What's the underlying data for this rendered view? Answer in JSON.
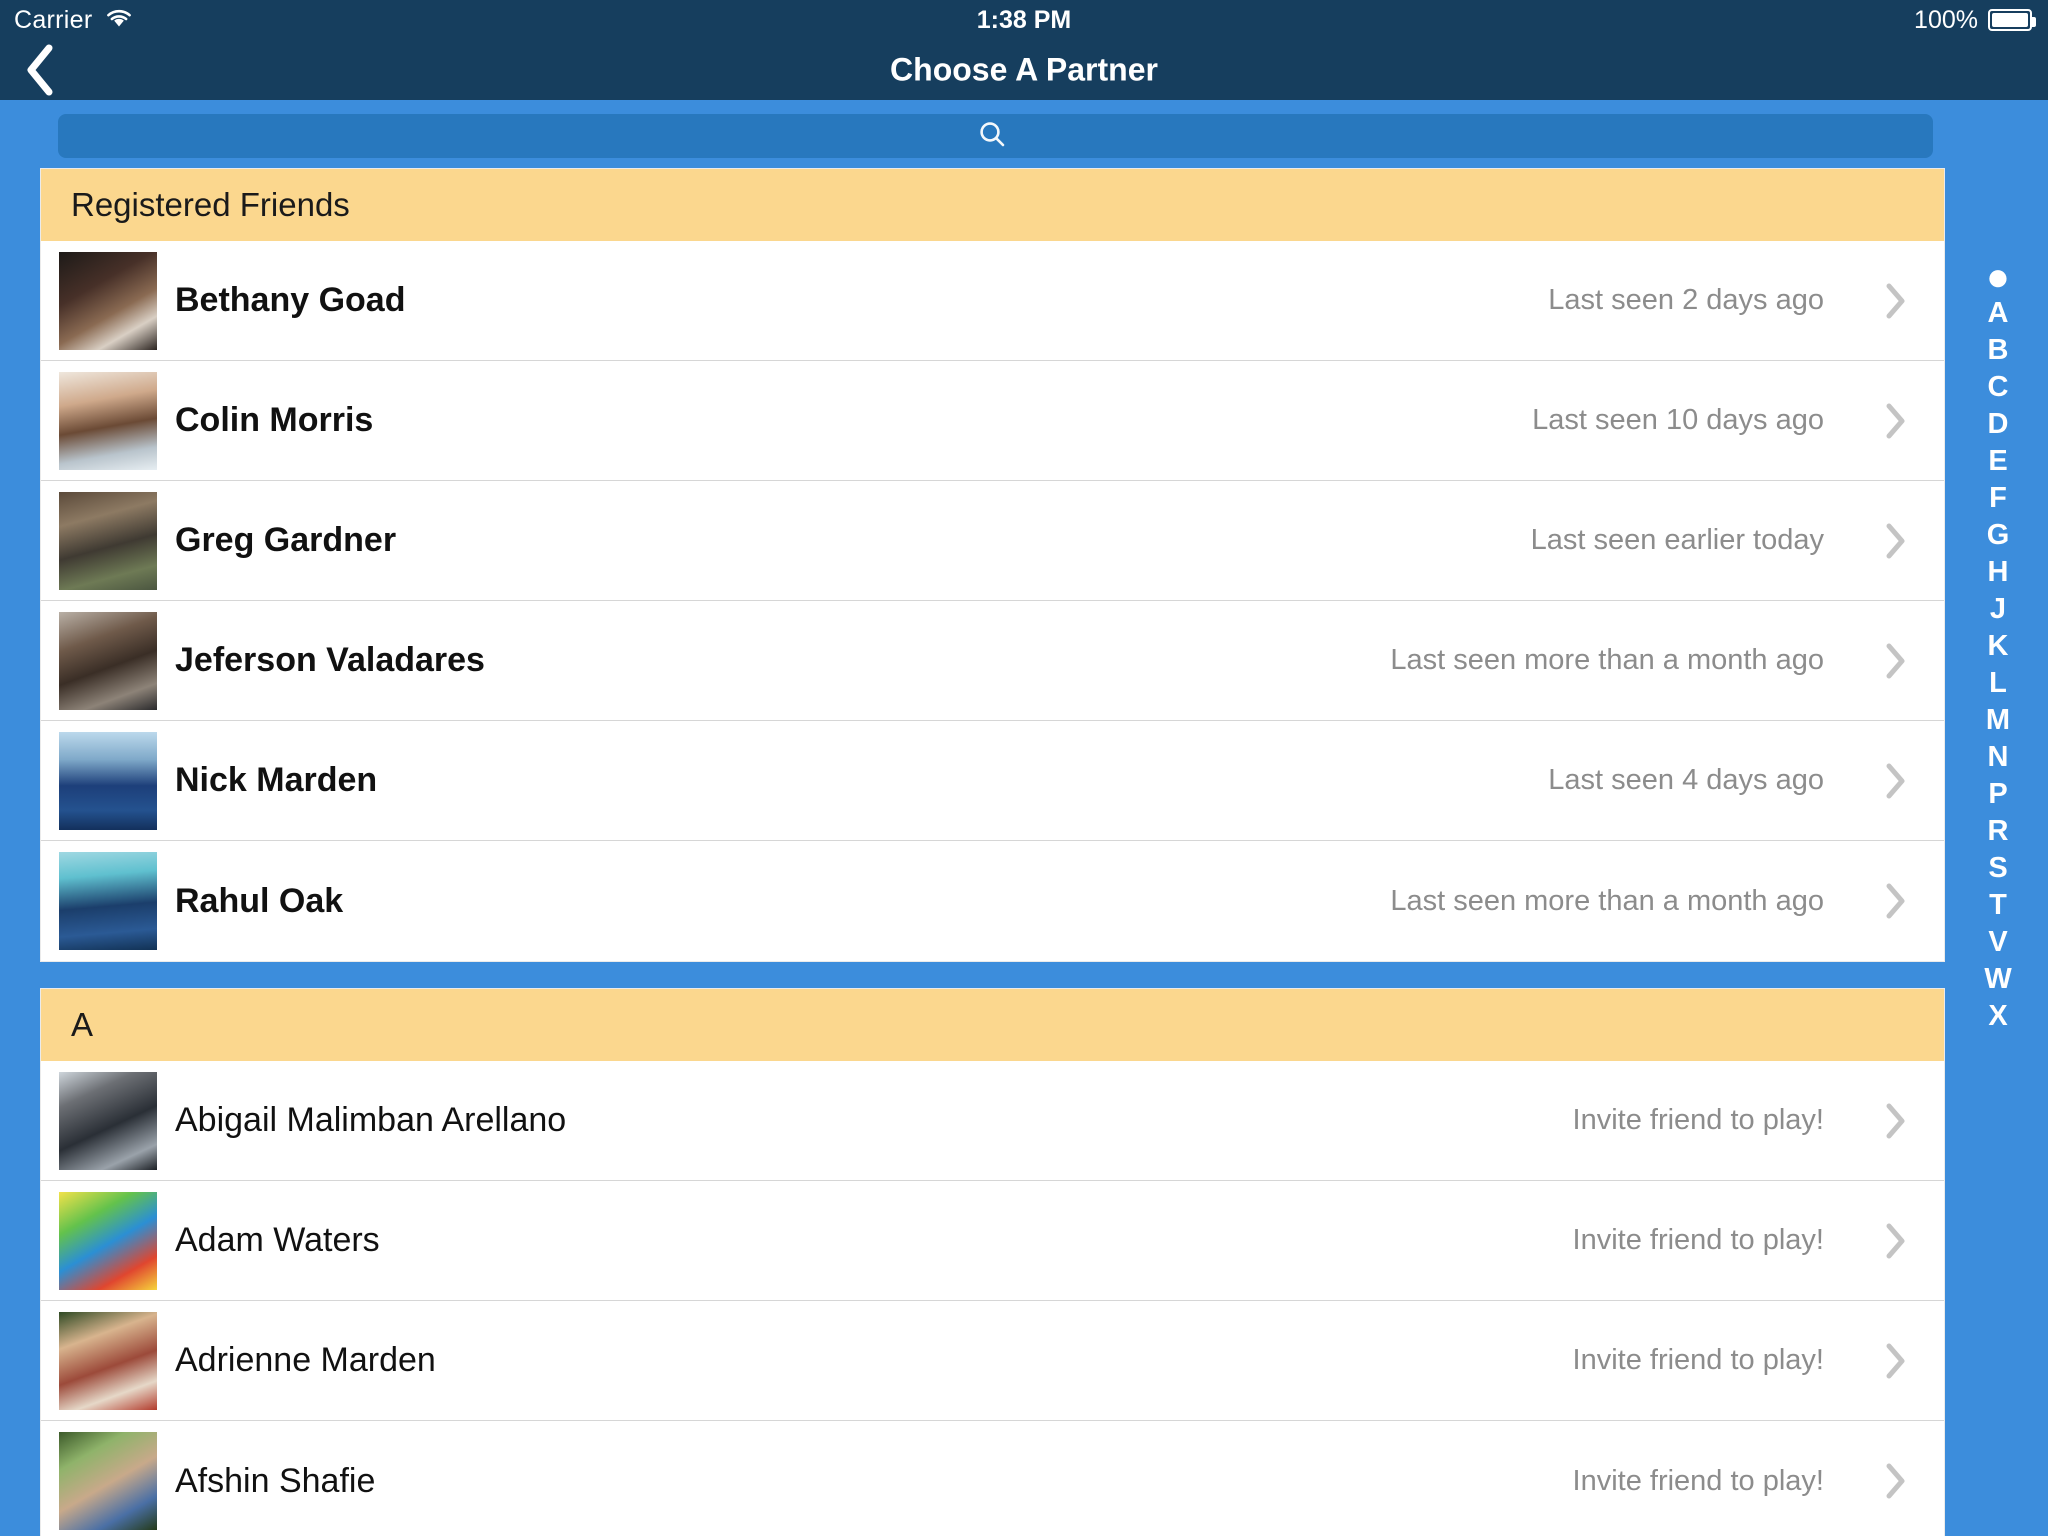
{
  "statusbar": {
    "carrier": "Carrier",
    "wifi_icon": "wifi-icon",
    "time": "1:38 PM",
    "battery_percent": "100%",
    "battery_icon": "battery-full-icon"
  },
  "navbar": {
    "back_icon": "back-chevron-icon",
    "title": "Choose A Partner"
  },
  "search": {
    "icon": "search-icon",
    "value": "",
    "placeholder": ""
  },
  "sections": [
    {
      "title": "Registered Friends",
      "rows": [
        {
          "name": "Bethany Goad",
          "status": "Last seen 2 days ago",
          "registered": true,
          "avatar": "av0"
        },
        {
          "name": "Colin Morris",
          "status": "Last seen 10 days ago",
          "registered": true,
          "avatar": "av1"
        },
        {
          "name": "Greg Gardner",
          "status": "Last seen earlier today",
          "registered": true,
          "avatar": "av2"
        },
        {
          "name": "Jeferson Valadares",
          "status": "Last seen more than a month ago",
          "registered": true,
          "avatar": "av3"
        },
        {
          "name": "Nick Marden",
          "status": "Last seen 4 days ago",
          "registered": true,
          "avatar": "av4"
        },
        {
          "name": "Rahul Oak",
          "status": "Last seen more than a month ago",
          "registered": true,
          "avatar": "av5"
        }
      ]
    },
    {
      "title": "A",
      "rows": [
        {
          "name": "Abigail Malimban Arellano",
          "status": "Invite friend to play!",
          "registered": false,
          "avatar": "av6"
        },
        {
          "name": "Adam Waters",
          "status": "Invite friend to play!",
          "registered": false,
          "avatar": "av7"
        },
        {
          "name": "Adrienne Marden",
          "status": "Invite friend to play!",
          "registered": false,
          "avatar": "av8"
        },
        {
          "name": "Afshin Shafie",
          "status": "Invite friend to play!",
          "registered": false,
          "avatar": "av9"
        }
      ]
    }
  ],
  "index_bar": [
    "●",
    "A",
    "B",
    "C",
    "D",
    "E",
    "F",
    "G",
    "H",
    "J",
    "K",
    "L",
    "M",
    "N",
    "P",
    "R",
    "S",
    "T",
    "V",
    "W",
    "X"
  ],
  "colors": {
    "navbar": "#163e5e",
    "page_background": "#3c8ddc",
    "search_field": "#2878be",
    "section_header": "#fbd78e",
    "row_background": "#ffffff",
    "status_text": "#8c8c8c",
    "chevron": "#c4c4c4"
  }
}
